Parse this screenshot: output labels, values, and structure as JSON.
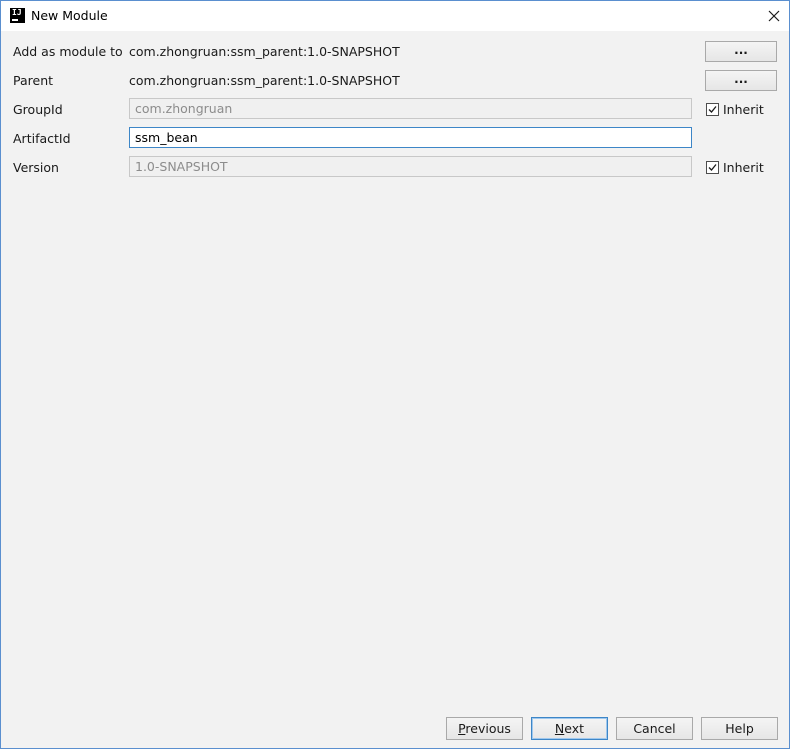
{
  "window": {
    "title": "New Module",
    "app_icon": "intellij-icon",
    "close_icon": "close-icon"
  },
  "form": {
    "add_as_module_label": "Add as module to",
    "add_as_module_value": "com.zhongruan:ssm_parent:1.0-SNAPSHOT",
    "parent_label": "Parent",
    "parent_value": "com.zhongruan:ssm_parent:1.0-SNAPSHOT",
    "browse_label": "...",
    "groupid_label": "GroupId",
    "groupid_value": "com.zhongruan",
    "artifactid_label": "ArtifactId",
    "artifactid_value": "ssm_bean",
    "version_label": "Version",
    "version_value": "1.0-SNAPSHOT",
    "inherit_label": "Inherit",
    "groupid_inherit_checked": true,
    "version_inherit_checked": true
  },
  "footer": {
    "previous_mnemonic": "P",
    "previous_rest": "revious",
    "next_mnemonic": "N",
    "next_rest": "ext",
    "cancel_label": "Cancel",
    "help_label": "Help"
  },
  "colors": {
    "accent_border": "#3d86c7",
    "window_border": "#5a8fcf",
    "background": "#f2f2f2"
  }
}
